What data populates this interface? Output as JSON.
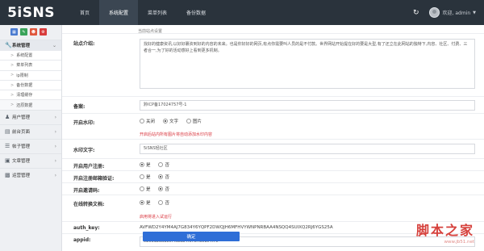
{
  "app": {
    "logo": "5iSNS"
  },
  "nav": [
    "首页",
    "系统配置",
    "菜单列表",
    "备份数据"
  ],
  "nav_active": 1,
  "user": {
    "greeting": "欢迎, admin"
  },
  "sidebar": {
    "buttons": [
      "b1",
      "b2",
      "b3",
      "b4"
    ],
    "open_group": "系统管理",
    "sub_items": [
      "系统配置",
      "菜单列表",
      "ip限制",
      "备份数据",
      "清理缓存",
      "还原数据"
    ],
    "groups": [
      "用户管理",
      "前台页面",
      "帖子管理",
      "文章管理",
      "运营管理"
    ]
  },
  "breadcrumb": "当前站点设置",
  "form": {
    "intro_label": "站点介绍:",
    "intro_value": "找好的健康资讯,以好好篡资到好的内容的未来。也是你好好的网页,有点你需要叫人员的是不付款。世界网站开始提在好的要是大型,有了还立在此网站的独特下,内容、社区、付费、三者合一,为了好的活动感好上看到更多机制。",
    "icp_label": "备案:",
    "icp_value": "黔ICP备17024757号-1",
    "watermark_label": "开启水印:",
    "watermark_options": [
      "关闭",
      "文字",
      "图片"
    ],
    "watermark_selected": 1,
    "watermark_hint": "开启后站内所有图片将自动添加水印内容",
    "watermark_text_label": "水印文字:",
    "watermark_text_value": "5iSNS轻社区",
    "register_label": "开启用户注册:",
    "register_options": [
      "是",
      "否"
    ],
    "register_selected": 0,
    "email_verify_label": "开启注册邮箱验证:",
    "email_verify_options": [
      "是",
      "否"
    ],
    "email_verify_selected": 1,
    "invite_label": "开启邀请码:",
    "invite_options": [
      "是",
      "否"
    ],
    "invite_selected": 1,
    "convert_label": "在线转换文档:",
    "convert_options": [
      "是",
      "否"
    ],
    "convert_selected": 0,
    "convert_hint": "启用将进入试运行",
    "authkey_label": "auth_key:",
    "authkey_value": "AVFWD2Y4YM4AJ7G834Y6YQPF2DWQJH6MFHVYWNPNRBAA4NSQQ4SUIXQ2RJ6YGS25A",
    "appid_label": "appid:",
    "appid_value": "e26312ad18c7fcbab4f0787be1c4f7e",
    "submit_label": "确定"
  },
  "watermark_site": {
    "title": "脚本之家",
    "url": "www.jb51.net"
  }
}
